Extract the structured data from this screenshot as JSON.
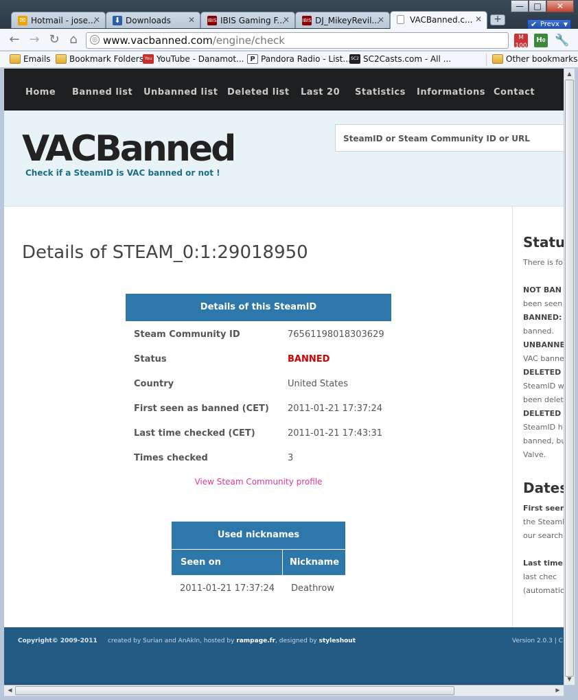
{
  "browser": {
    "tabs": [
      {
        "label": "Hotmail - jose...",
        "icon": "mail-icon",
        "color": "#f2a200",
        "glyph": "✉"
      },
      {
        "label": "Downloads",
        "icon": "download-icon",
        "color": "#2b5fa8",
        "glyph": "⬇"
      },
      {
        "label": "IBIS Gaming F...",
        "icon": "ibis-icon",
        "color": "#8b0000",
        "glyph": "I"
      },
      {
        "label": "DJ_MikeyRevil...",
        "icon": "ibis-icon",
        "color": "#8b0000",
        "glyph": "I"
      },
      {
        "label": "VACBanned.c...",
        "icon": "page-icon",
        "color": "#eeeeee",
        "glyph": ""
      }
    ],
    "window_buttons": {
      "minimize": "—",
      "maximize": "□",
      "close": "✕"
    },
    "prevx_label": "Prevx",
    "url_host": "www.vacbanned.com",
    "url_path": "/engine/check",
    "gmail_count": "100",
    "ext_count": "0",
    "bookmarks": [
      {
        "label": "Emails",
        "icon": "folder-icon"
      },
      {
        "label": "Bookmark Folders",
        "icon": "folder-icon"
      },
      {
        "label": "YouTube - Danamot...",
        "icon": "youtube-icon"
      },
      {
        "label": "Pandora Radio - List...",
        "icon": "pandora-icon"
      },
      {
        "label": "SC2Casts.com - All ...",
        "icon": "sc2casts-icon"
      }
    ],
    "other_bookmarks": "Other bookmarks"
  },
  "site": {
    "nav": [
      "Home",
      "Banned list",
      "Unbanned list",
      "Deleted list",
      "Last 20",
      "Statistics",
      "Informations",
      "Contact"
    ],
    "logo": "VACBanned",
    "tagline": "Check if a SteamID is VAC banned or not !",
    "search_placeholder": "SteamID or Steam Community ID or URL",
    "page_title": "Details of STEAM_0:1:29018950",
    "details": {
      "header": "Details of this SteamID",
      "rows": [
        {
          "key": "Steam Community ID",
          "value": "76561198018303629"
        },
        {
          "key": "Status",
          "value": "BANNED"
        },
        {
          "key": "Country",
          "value": "United States"
        },
        {
          "key": "First seen as banned (CET)",
          "value": "2011-01-21 17:37:24"
        },
        {
          "key": "Last time checked (CET)",
          "value": "2011-01-21 17:43:31"
        },
        {
          "key": "Times checked",
          "value": "3"
        }
      ]
    },
    "profile_link": "View Steam Community profile",
    "nicknames": {
      "header": "Used nicknames",
      "col_seen": "Seen on",
      "col_nick": "Nickname",
      "rows": [
        {
          "seen": "2011-01-21 17:37:24",
          "nick": "Deathrow"
        }
      ]
    },
    "sidebar": {
      "status_title": "Status",
      "status_lines": [
        "There is fo",
        "",
        "NOT BAN",
        "been seen",
        "BANNED:",
        "banned.",
        "UNBANNE",
        "VAC banne",
        "DELETED",
        "SteamID wa",
        "been delete",
        "DELETED",
        "SteamID h",
        "banned, bu",
        "Valve."
      ],
      "dates_title": "Dates",
      "dates_lines": [
        "First seen",
        "the SteamII",
        "our search",
        "",
        "Last time",
        "last chec",
        "(automatic"
      ]
    },
    "footer": {
      "copyright": "Copyright© 2009-2011",
      "credits_a": "created by Surian and AnAkIn, hosted by ",
      "host": "rampage.fr",
      "credits_b": ", designed by ",
      "designer": "styleshout",
      "version": "Version 2.0.3 | C"
    },
    "colors": {
      "accent": "#2e77aa",
      "banned": "#d40000",
      "link": "#e0369b"
    }
  }
}
